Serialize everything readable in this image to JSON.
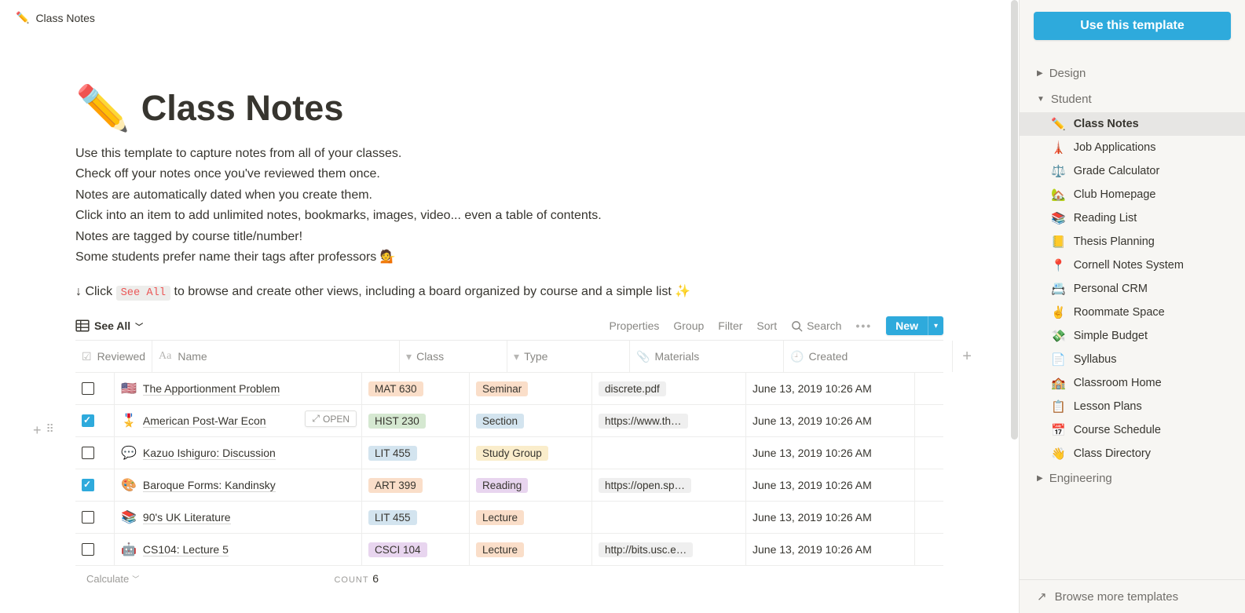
{
  "breadcrumb": {
    "icon": "✏️",
    "title": "Class Notes"
  },
  "page": {
    "icon": "✏️",
    "title": "Class Notes",
    "desc": [
      "Use this template to capture notes from all of your classes.",
      "Check off your notes once you've reviewed them once.",
      "Notes are automatically dated when you create them.",
      "Click into an item to add unlimited notes, bookmarks, images, video... even a table of contents.",
      "Notes are tagged by course title/number!",
      "Some students prefer name their tags after professors 💁"
    ],
    "see_all_line_prefix": "↓ Click ",
    "see_all_pill": "See All",
    "see_all_line_suffix": " to browse and create other views, including a board organized by course and a simple list ✨"
  },
  "viewbar": {
    "view_label": "See All",
    "properties": "Properties",
    "group": "Group",
    "filter": "Filter",
    "sort": "Sort",
    "search": "Search",
    "new": "New"
  },
  "table": {
    "headers": {
      "reviewed": "Reviewed",
      "name": "Name",
      "class": "Class",
      "type": "Type",
      "materials": "Materials",
      "created": "Created"
    },
    "open_label": "OPEN",
    "rows": [
      {
        "reviewed": false,
        "icon": "🇺🇸",
        "name": "The Apportionment Problem",
        "class": {
          "label": "MAT 630",
          "bg": "#fadec9"
        },
        "type": {
          "label": "Seminar",
          "bg": "#fadec9"
        },
        "materials": "discrete.pdf",
        "created": "June 13, 2019 10:26 AM"
      },
      {
        "reviewed": true,
        "icon": "🎖️",
        "name": "American Post-War Econ",
        "class": {
          "label": "HIST 230",
          "bg": "#d5e8d1"
        },
        "type": {
          "label": "Section",
          "bg": "#d3e4ef"
        },
        "materials": "https://www.th…",
        "created": "June 13, 2019 10:26 AM",
        "hovered": true
      },
      {
        "reviewed": false,
        "icon": "💬",
        "name": "Kazuo Ishiguro: Discussion",
        "class": {
          "label": "LIT 455",
          "bg": "#d3e4ef"
        },
        "type": {
          "label": "Study Group",
          "bg": "#faedcb"
        },
        "materials": "",
        "created": "June 13, 2019 10:26 AM"
      },
      {
        "reviewed": true,
        "icon": "🎨",
        "name": "Baroque Forms: Kandinsky",
        "class": {
          "label": "ART 399",
          "bg": "#fadec9"
        },
        "type": {
          "label": "Reading",
          "bg": "#e8d5ef"
        },
        "materials": "https://open.sp…",
        "created": "June 13, 2019 10:26 AM"
      },
      {
        "reviewed": false,
        "icon": "📚",
        "name": "90's UK Literature",
        "class": {
          "label": "LIT 455",
          "bg": "#d3e4ef"
        },
        "type": {
          "label": "Lecture",
          "bg": "#fadec9"
        },
        "materials": "",
        "created": "June 13, 2019 10:26 AM"
      },
      {
        "reviewed": false,
        "icon": "🤖",
        "name": "CS104: Lecture 5",
        "class": {
          "label": "CSCI 104",
          "bg": "#e8d5ef"
        },
        "type": {
          "label": "Lecture",
          "bg": "#fadec9"
        },
        "materials": "http://bits.usc.e…",
        "created": "June 13, 2019 10:26 AM"
      }
    ],
    "footer": {
      "calc": "Calculate",
      "count_label": "COUNT",
      "count_value": "6"
    }
  },
  "sidebar": {
    "use_template": "Use this template",
    "cats": [
      {
        "label": "Design",
        "expanded": false
      },
      {
        "label": "Student",
        "expanded": true,
        "items": [
          {
            "icon": "✏️",
            "label": "Class Notes",
            "active": true
          },
          {
            "icon": "🗼",
            "label": "Job Applications"
          },
          {
            "icon": "⚖️",
            "label": "Grade Calculator"
          },
          {
            "icon": "🏡",
            "label": "Club Homepage"
          },
          {
            "icon": "📚",
            "label": "Reading List"
          },
          {
            "icon": "📒",
            "label": "Thesis Planning"
          },
          {
            "icon": "📍",
            "label": "Cornell Notes System"
          },
          {
            "icon": "📇",
            "label": "Personal CRM"
          },
          {
            "icon": "✌️",
            "label": "Roommate Space"
          },
          {
            "icon": "💸",
            "label": "Simple Budget"
          },
          {
            "icon": "📄",
            "label": "Syllabus"
          },
          {
            "icon": "🏫",
            "label": "Classroom Home"
          },
          {
            "icon": "📋",
            "label": "Lesson Plans"
          },
          {
            "icon": "📅",
            "label": "Course Schedule"
          },
          {
            "icon": "👋",
            "label": "Class Directory"
          }
        ]
      },
      {
        "label": "Engineering",
        "expanded": false
      }
    ],
    "browse": "Browse more templates"
  }
}
